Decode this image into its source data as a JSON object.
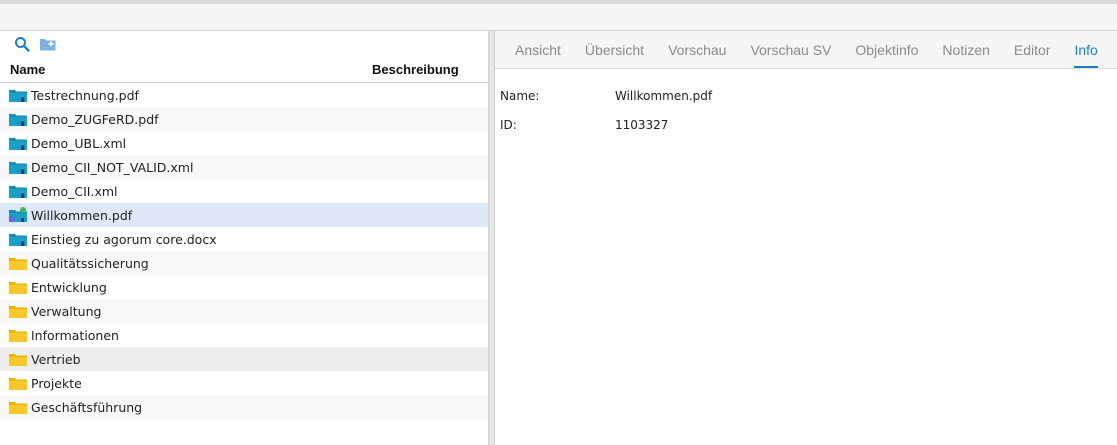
{
  "left": {
    "columns": {
      "name": "Name",
      "description": "Beschreibung"
    },
    "items": [
      {
        "label": "Testrechnung.pdf",
        "icon": "cloud-file-icon"
      },
      {
        "label": "Demo_ZUGFeRD.pdf",
        "icon": "cloud-file-icon"
      },
      {
        "label": "Demo_UBL.xml",
        "icon": "cloud-file-icon"
      },
      {
        "label": "Demo_CII_NOT_VALID.xml",
        "icon": "cloud-file-icon"
      },
      {
        "label": "Demo_CII.xml",
        "icon": "cloud-file-icon"
      },
      {
        "label": "Willkommen.pdf",
        "icon": "linked-file-icon"
      },
      {
        "label": "Einstieg zu agorum core.docx",
        "icon": "cloud-file-icon"
      },
      {
        "label": "Qualitätssicherung",
        "icon": "folder-icon"
      },
      {
        "label": "Entwicklung",
        "icon": "folder-icon"
      },
      {
        "label": "Verwaltung",
        "icon": "folder-icon"
      },
      {
        "label": "Informationen",
        "icon": "folder-icon"
      },
      {
        "label": "Vertrieb",
        "icon": "folder-icon"
      },
      {
        "label": "Projekte",
        "icon": "folder-icon"
      },
      {
        "label": "Geschäftsführung",
        "icon": "folder-icon"
      }
    ],
    "selected_index": 5,
    "hover_index": 11
  },
  "right": {
    "tabs": [
      {
        "label": "Ansicht"
      },
      {
        "label": "Übersicht"
      },
      {
        "label": "Vorschau"
      },
      {
        "label": "Vorschau SV"
      },
      {
        "label": "Objektinfo"
      },
      {
        "label": "Notizen"
      },
      {
        "label": "Editor"
      },
      {
        "label": "Info"
      }
    ],
    "active_tab": "Info",
    "info": [
      {
        "key": "Name:",
        "value": "Willkommen.pdf"
      },
      {
        "key": "ID:",
        "value": "1103327"
      }
    ]
  },
  "colors": {
    "accent": "#1e7fc8",
    "folder": "#f5c518",
    "cloud": "#1aa0c8",
    "selected_row": "#dfe8f6"
  }
}
